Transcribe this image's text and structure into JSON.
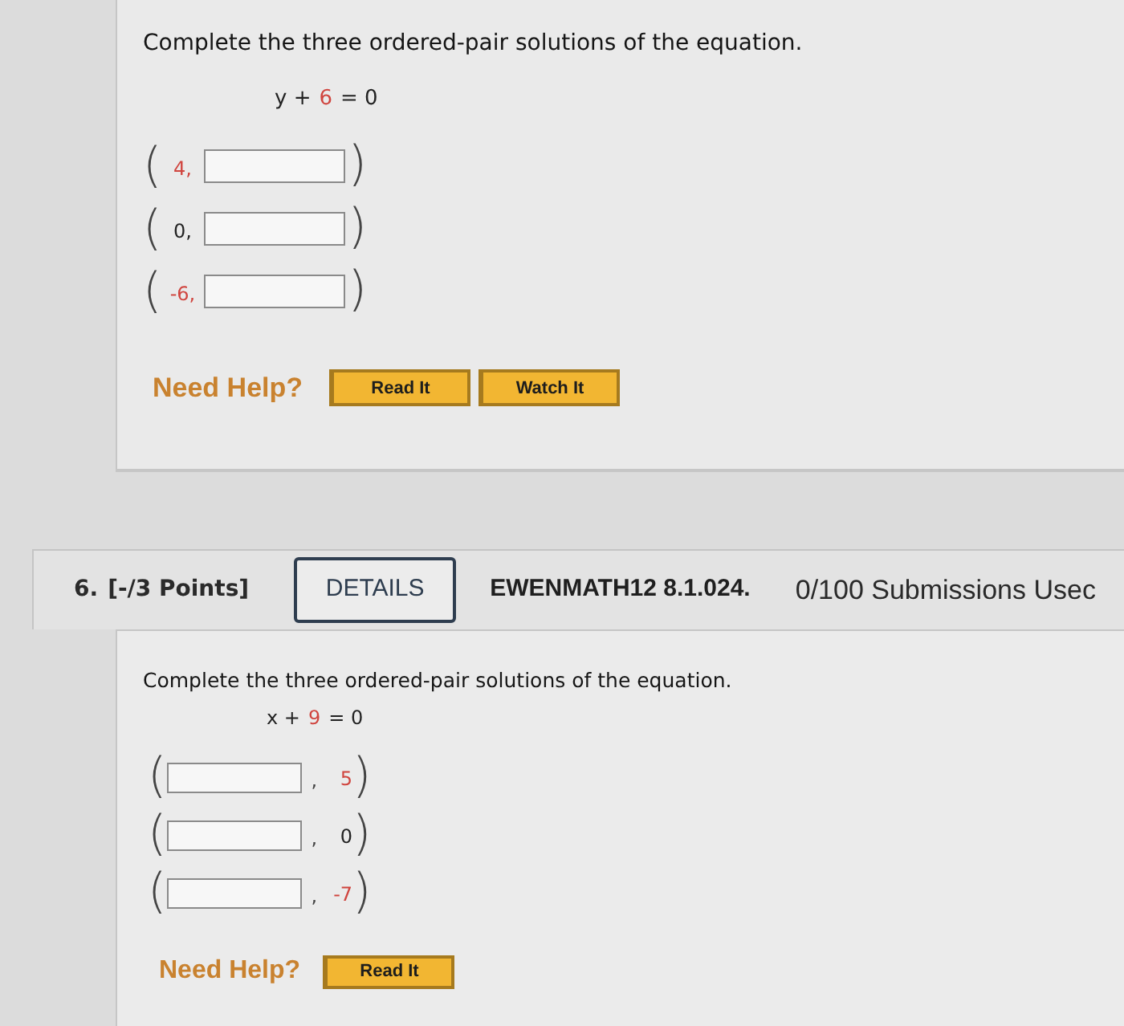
{
  "questions": [
    {
      "prompt": "Complete the three ordered-pair solutions of the equation.",
      "equation": [
        {
          "text": "y +",
          "highlight": false
        },
        {
          "text": "6",
          "highlight": true
        },
        {
          "text": "= 0",
          "highlight": false
        }
      ],
      "pairs": [
        {
          "kind": "x_given",
          "open": "(",
          "value": "4,",
          "highlight": true,
          "close": ")"
        },
        {
          "kind": "x_given",
          "open": "(",
          "value": "0,",
          "highlight": false,
          "close": ")"
        },
        {
          "kind": "x_given",
          "open": "(",
          "value": "-6,",
          "highlight": true,
          "close": ")"
        }
      ],
      "help": {
        "label": "Need Help?",
        "buttons": [
          "Read It",
          "Watch It"
        ]
      }
    },
    {
      "header": {
        "number": "6.",
        "points": "[-/3 Points]",
        "details": "DETAILS",
        "problem_id": "EWENMATH12 8.1.024.",
        "submissions": "0/100 Submissions Usec"
      },
      "prompt": "Complete the three ordered-pair solutions of the equation.",
      "equation": [
        {
          "text": "x +",
          "highlight": false
        },
        {
          "text": "9",
          "highlight": true
        },
        {
          "text": "= 0",
          "highlight": false
        }
      ],
      "pairs": [
        {
          "kind": "y_given",
          "open": "(",
          "separator": ",",
          "value": "5",
          "highlight": true,
          "close": ")"
        },
        {
          "kind": "y_given",
          "open": "(",
          "separator": ",",
          "value": "0",
          "highlight": false,
          "close": ")"
        },
        {
          "kind": "y_given",
          "open": "(",
          "separator": ",",
          "value": "-7",
          "highlight": true,
          "close": ")"
        }
      ],
      "help": {
        "label": "Need Help?",
        "buttons": [
          "Read It"
        ]
      }
    }
  ]
}
